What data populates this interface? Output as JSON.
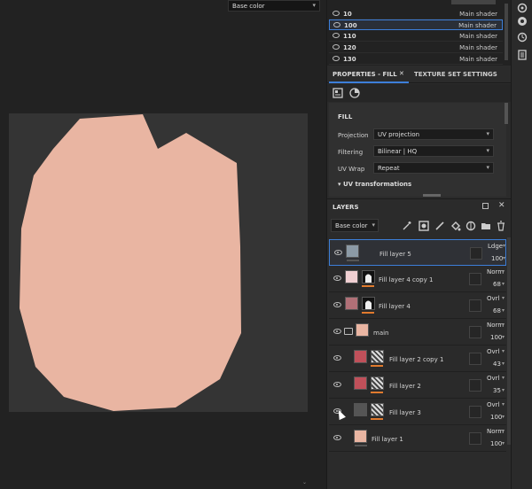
{
  "viewport": {
    "channel_select": "Base color",
    "uv_fill_color": "#e9b5a2",
    "canvas_color": "#343434"
  },
  "texture_sets": [
    {
      "name": "10",
      "shader": "Main shader",
      "selected": false
    },
    {
      "name": "100",
      "shader": "Main shader",
      "selected": true
    },
    {
      "name": "110",
      "shader": "Main shader",
      "selected": false
    },
    {
      "name": "120",
      "shader": "Main shader",
      "selected": false
    },
    {
      "name": "130",
      "shader": "Main shader",
      "selected": false
    }
  ],
  "properties": {
    "tab_active": "PROPERTIES - FILL",
    "tab_close": "✕",
    "tab_other": "TEXTURE SET SETTINGS",
    "section": "FILL",
    "rows": [
      {
        "label": "Projection",
        "value": "UV projection"
      },
      {
        "label": "Filtering",
        "value": "Bilinear | HQ"
      },
      {
        "label": "UV Wrap",
        "value": "Repeat"
      }
    ],
    "subsection": "UV transformations"
  },
  "layers_panel": {
    "title": "LAYERS",
    "blend_select": "Base color",
    "toolbar_icons": [
      "add-effect-icon",
      "add-mask-icon",
      "paint-layer-icon",
      "fill-layer-icon",
      "smart-material-icon",
      "folder-icon",
      "trash-icon"
    ],
    "layers": [
      {
        "name": "Fill layer 5",
        "blend": "Ldge",
        "opacity": "100",
        "color": "#8c9aa6",
        "mask": "none",
        "selected": true,
        "type": "fill"
      },
      {
        "name": "Fill layer 4 copy 1",
        "blend": "Norm",
        "opacity": "68",
        "color": "#f0cfd2",
        "mask": "black",
        "selected": false,
        "type": "fill"
      },
      {
        "name": "Fill layer 4",
        "blend": "Ovrl",
        "opacity": "68",
        "color": "#b07077",
        "mask": "black",
        "selected": false,
        "type": "fill"
      },
      {
        "name": "main",
        "blend": "Norm",
        "opacity": "100",
        "color": "#e9b5a2",
        "mask": "none",
        "selected": false,
        "type": "folder"
      },
      {
        "name": "Fill layer 2 copy 1",
        "blend": "Ovrl",
        "opacity": "43",
        "color": "#c0505a",
        "mask": "noise",
        "selected": false,
        "type": "fill"
      },
      {
        "name": "Fill layer 2",
        "blend": "Ovrl",
        "opacity": "35",
        "color": "#c0505a",
        "mask": "noise",
        "selected": false,
        "type": "fill"
      },
      {
        "name": "Fill layer 3",
        "blend": "Ovrl",
        "opacity": "100",
        "color": "#555555",
        "mask": "noise",
        "selected": false,
        "type": "fill"
      },
      {
        "name": "Fill layer 1",
        "blend": "Norm",
        "opacity": "100",
        "color": "#e9b5a2",
        "mask": "none",
        "selected": false,
        "type": "fill"
      }
    ]
  },
  "right_toolbar": [
    "settings-icon",
    "history-icon",
    "clock-icon",
    "log-icon"
  ]
}
